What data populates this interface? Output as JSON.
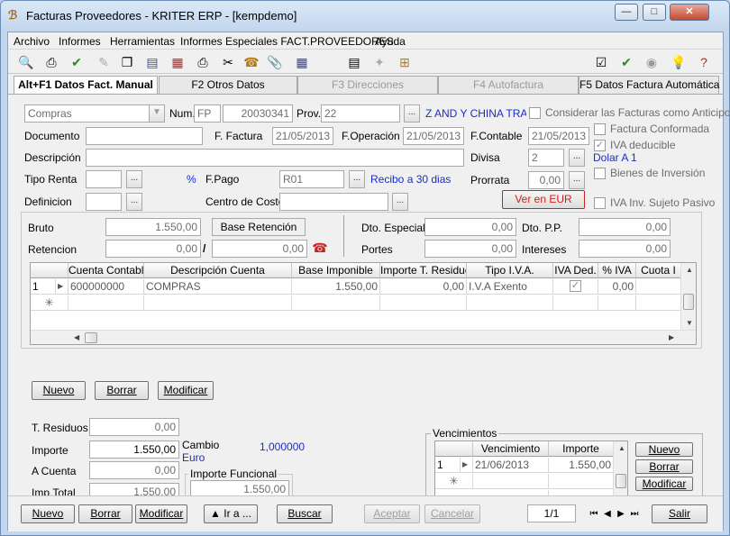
{
  "window": {
    "title": "Facturas Proveedores  - KRITER ERP - [kempdemo]",
    "minimize": "—",
    "maximize": "□",
    "close": "✕"
  },
  "menu": [
    "Archivo",
    "Informes",
    "Herramientas",
    "Informes Especiales FACT.PROVEEDORES",
    "Ayuda"
  ],
  "tabs": [
    {
      "label": "Alt+F1 Datos Fact. Manual",
      "state": "active"
    },
    {
      "label": "F2 Otros Datos",
      "state": "normal"
    },
    {
      "label": "F3 Direcciones",
      "state": "disabled"
    },
    {
      "label": "F4 Autofactura",
      "state": "disabled"
    },
    {
      "label": "F5 Datos Factura Automática",
      "state": "normal"
    }
  ],
  "header": {
    "tipo_value": "Compras",
    "num_label": "Num.",
    "num_serie": "FP",
    "num_value": "20030341",
    "prov_label": "Prov.",
    "prov_value": "22",
    "prov_name": "Z AND Y CHINA TRAD",
    "documento_label": "Documento",
    "fecha_factura_label": "F. Factura",
    "fecha_factura": "21/05/2013",
    "fecha_operacion_label": "F.Operación",
    "fecha_operacion": "21/05/2013",
    "fecha_contable_label": "F.Contable",
    "fecha_contable": "21/05/2013",
    "descripcion_label": "Descripción",
    "divisa_label": "Divisa",
    "divisa_value": "2",
    "divisa_name": "Dolar A 1",
    "tipo_renta_label": "Tipo Renta",
    "percent": "%",
    "fpago_label": "F.Pago",
    "fpago_value": "R01",
    "fpago_name": "Recibo a 30 dias",
    "prorrata_label": "Prorrata",
    "prorrata_value": "0,00",
    "definicion_label": "Definicion",
    "centro_coste_label": "Centro de Coste",
    "ver_eur_button": "Ver en EUR",
    "ellipsis": "..."
  },
  "checkboxes": {
    "anticipos": {
      "label": "Considerar las Facturas como Anticipos",
      "checked": false
    },
    "conformada": {
      "label": "Factura Conformada",
      "checked": false
    },
    "iva_deducible": {
      "label": "IVA deducible",
      "checked": true
    },
    "bienes_inversion": {
      "label": "Bienes de Inversión",
      "checked": false
    },
    "iva_sujeto_pasivo": {
      "label": "IVA Inv. Sujeto Pasivo",
      "checked": false
    }
  },
  "totals_top": {
    "bruto_label": "Bruto",
    "bruto": "1.550,00",
    "base_retencion_label": "Base Retención",
    "retencion_label": "Retencion",
    "retencion": "0,00",
    "slash": "/",
    "retencion_importe": "0,00",
    "dto_especial_label": "Dto. Especial",
    "dto_especial": "0,00",
    "dto_pp_label": "Dto. P.P.",
    "dto_pp": "0,00",
    "portes_label": "Portes",
    "portes": "0,00",
    "intereses_label": "Intereses",
    "intereses": "0,00"
  },
  "lines_grid": {
    "columns": [
      "Cuenta Contable",
      "Descripción Cuenta",
      "Base Imponible",
      "Importe T. Residuos",
      "Tipo I.V.A.",
      "IVA Ded.",
      "% IVA",
      "Cuota I"
    ],
    "rows": [
      {
        "num": "1",
        "cuenta": "600000000",
        "descripcion": "COMPRAS",
        "base": "1.550,00",
        "residuos": "0,00",
        "tipo_iva": "I.V.A Exento",
        "iva_ded": true,
        "pct_iva": "0,00",
        "cuota": ""
      }
    ],
    "new_row_marker": "✳"
  },
  "grid_buttons": {
    "nuevo": "Nuevo",
    "borrar": "Borrar",
    "modificar": "Modificar"
  },
  "totals_bottom": {
    "residuos_label": "T. Residuos",
    "residuos": "0,00",
    "importe_label": "Importe",
    "importe": "1.550,00",
    "a_cuenta_label": "A Cuenta",
    "a_cuenta": "0,00",
    "total_label": "Imp.Total",
    "total": "1.550,00",
    "cambio_label": "Cambio",
    "cambio": "1,000000",
    "moneda": "Euro",
    "importe_funcional_label": "Importe Funcional",
    "importe_funcional": "1.550,00"
  },
  "vencimientos": {
    "title": "Vencimientos",
    "columns": [
      "Vencimiento",
      "Importe"
    ],
    "rows": [
      {
        "num": "1",
        "fecha": "21/06/2013",
        "importe": "1.550,00"
      }
    ],
    "nuevo": "Nuevo",
    "borrar": "Borrar",
    "modificar": "Modificar"
  },
  "footer": {
    "nuevo": "Nuevo",
    "borrar": "Borrar",
    "modificar": "Modificar",
    "ir_a": "▲  Ir a ...",
    "buscar": "Buscar",
    "aceptar": "Aceptar",
    "cancelar": "Cancelar",
    "record": "1/1",
    "salir": "Salir"
  },
  "colors": {
    "accent_blue": "#1a2dc9",
    "titlebar": "#c2d6ee"
  }
}
